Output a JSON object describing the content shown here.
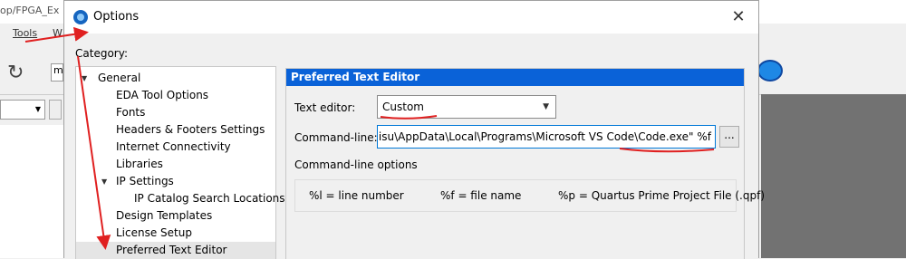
{
  "background": {
    "path_text": "op/FPGA_Ex",
    "menus": [
      "Tools",
      "W"
    ],
    "combo_text": "m"
  },
  "dialog": {
    "title": "Options",
    "category_label": "Category:",
    "tree": [
      {
        "label": "General",
        "level": 0,
        "expanded": true
      },
      {
        "label": "EDA Tool Options",
        "level": 1
      },
      {
        "label": "Fonts",
        "level": 1
      },
      {
        "label": "Headers & Footers Settings",
        "level": 1
      },
      {
        "label": "Internet Connectivity",
        "level": 1
      },
      {
        "label": "Libraries",
        "level": 1
      },
      {
        "label": "IP Settings",
        "level": 1,
        "expanded": true
      },
      {
        "label": "IP Catalog Search Locations",
        "level": 2
      },
      {
        "label": "Design Templates",
        "level": 1
      },
      {
        "label": "License Setup",
        "level": 1
      },
      {
        "label": "Preferred Text Editor",
        "level": 1,
        "selected": true
      }
    ],
    "panel": {
      "header": "Preferred Text Editor",
      "text_editor_label": "Text editor:",
      "text_editor_value": "Custom",
      "command_line_label": "Command-line:",
      "command_line_value": "rs\\Naisu\\AppData\\Local\\Programs\\Microsoft VS Code\\Code.exe\" %f",
      "browse_label": "...",
      "options_label": "Command-line options",
      "options": [
        "%l = line number",
        "%f = file name",
        "%p = Quartus Prime Project File (.qpf)"
      ]
    }
  },
  "colors": {
    "header_blue": "#0a62d8",
    "annotation_red": "#e02020"
  }
}
